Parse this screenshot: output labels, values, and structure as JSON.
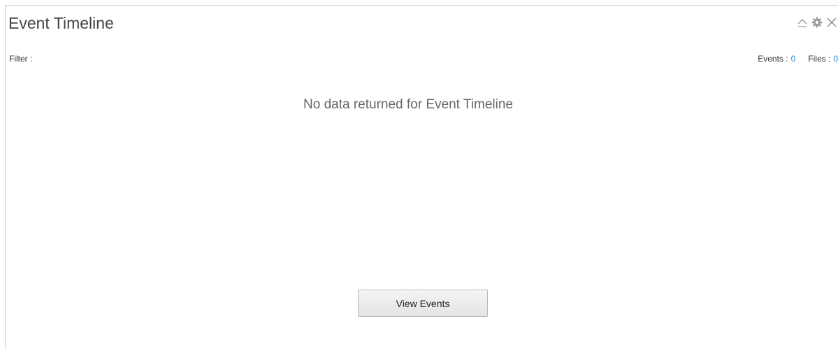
{
  "panel": {
    "title": "Event Timeline",
    "controls": {
      "collapse_icon": "chevron-up-icon",
      "settings_icon": "gear-icon",
      "close_icon": "close-icon"
    }
  },
  "filter": {
    "label": "Filter :"
  },
  "counts": {
    "events_label": "Events :",
    "events_value": "0",
    "files_label": "Files :",
    "files_value": "0"
  },
  "message": {
    "empty": "No data returned for Event Timeline"
  },
  "actions": {
    "view_events": "View Events"
  },
  "colors": {
    "link_value": "#1a8bd8",
    "border": "#cfcfcf"
  }
}
